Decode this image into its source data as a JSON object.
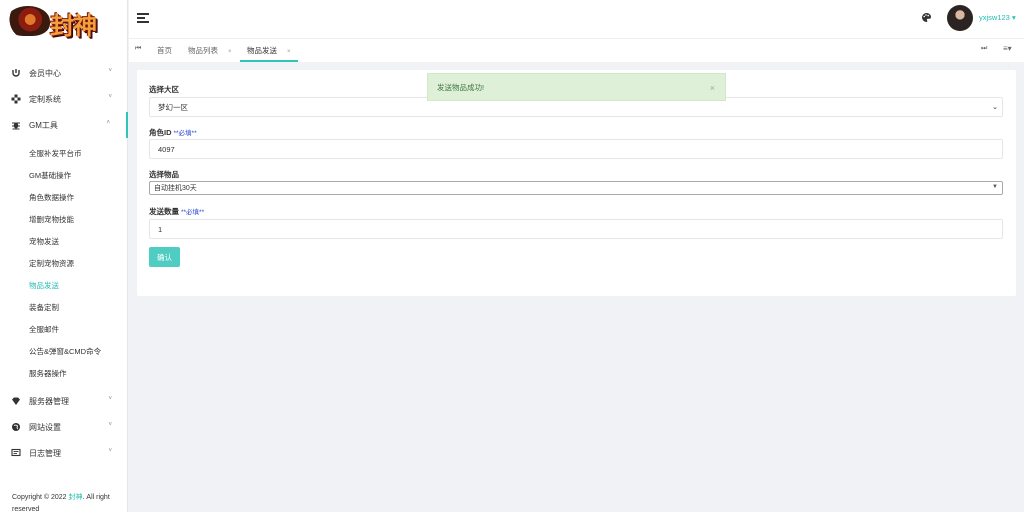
{
  "logo": {
    "text": "封神"
  },
  "sidebar": {
    "menu": [
      {
        "label": "会员中心",
        "icon": "user-icon"
      },
      {
        "label": "定制系统",
        "icon": "settings-icon"
      },
      {
        "label": "GM工具",
        "icon": "bug-icon"
      }
    ],
    "submenu": [
      "全服补发平台币",
      "GM基础操作",
      "角色数据操作",
      "增删宠物技能",
      "宠物发送",
      "定制宠物资源",
      "物品发送",
      "装备定制",
      "全服邮件",
      "公告&弹窗&CMD命令",
      "服务器操作"
    ],
    "active_submenu_index": 6,
    "menu_bottom": [
      {
        "label": "服务器管理",
        "icon": "diamond-icon"
      },
      {
        "label": "网站设置",
        "icon": "globe-icon"
      },
      {
        "label": "日志管理",
        "icon": "log-icon"
      }
    ],
    "copyright_prefix": "Copyright © 2022 ",
    "copyright_link": "封神",
    "copyright_suffix": ". All right reserved"
  },
  "header": {
    "username": "yxjsw123"
  },
  "tabs": [
    {
      "label": "首页",
      "closable": false
    },
    {
      "label": "物品列表",
      "closable": true
    },
    {
      "label": "物品发送",
      "closable": true,
      "active": true
    }
  ],
  "form": {
    "server_label": "选择大区",
    "server_value": "梦幻一区",
    "role_label": "角色ID",
    "role_required": "**必填**",
    "role_value": "4097",
    "item_label": "选择物品",
    "item_value": "自动挂机30天",
    "qty_label": "发送数量",
    "qty_required": "**必填**",
    "qty_value": "1",
    "confirm_label": "确认"
  },
  "toast": {
    "message": "发送物品成功!"
  },
  "colors": {
    "accent": "#31c4b8",
    "button": "#4fcdc2",
    "toast_bg": "#dff0d8",
    "toast_text": "#3c763d",
    "required": "#1e3cd8"
  }
}
